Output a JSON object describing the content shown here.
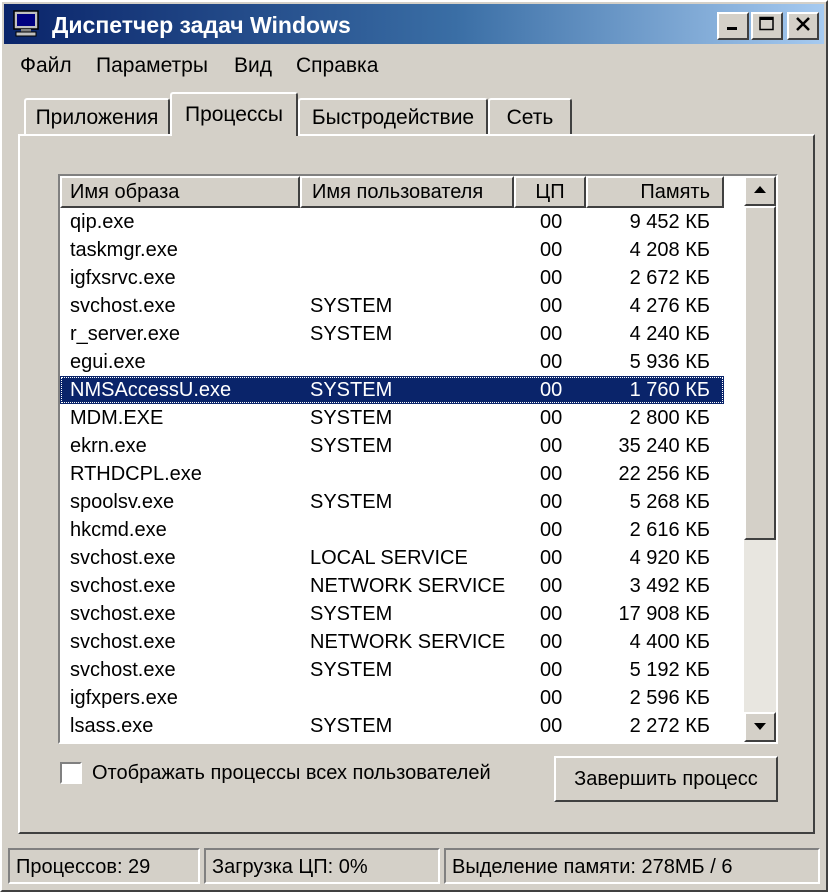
{
  "window": {
    "title": "Диспетчер задач Windows"
  },
  "menu": [
    {
      "label": "Файл"
    },
    {
      "label": "Параметры"
    },
    {
      "label": "Вид"
    },
    {
      "label": "Справка"
    }
  ],
  "tabs": [
    {
      "label": "Приложения",
      "active": false
    },
    {
      "label": "Процессы",
      "active": true
    },
    {
      "label": "Быстродействие",
      "active": false
    },
    {
      "label": "Сеть",
      "active": false
    }
  ],
  "table": {
    "columns": [
      "Имя образа",
      "Имя пользователя",
      "ЦП",
      "Память"
    ],
    "rows": [
      {
        "name": "qip.exe",
        "user": "",
        "cpu": "00",
        "mem": "9 452 КБ"
      },
      {
        "name": "taskmgr.exe",
        "user": "",
        "cpu": "00",
        "mem": "4 208 КБ"
      },
      {
        "name": "igfxsrvc.exe",
        "user": "",
        "cpu": "00",
        "mem": "2 672 КБ"
      },
      {
        "name": "svchost.exe",
        "user": "SYSTEM",
        "cpu": "00",
        "mem": "4 276 КБ"
      },
      {
        "name": "r_server.exe",
        "user": "SYSTEM",
        "cpu": "00",
        "mem": "4 240 КБ"
      },
      {
        "name": "egui.exe",
        "user": "",
        "cpu": "00",
        "mem": "5 936 КБ"
      },
      {
        "name": "NMSAccessU.exe",
        "user": "SYSTEM",
        "cpu": "00",
        "mem": "1 760 КБ",
        "selected": true
      },
      {
        "name": "MDM.EXE",
        "user": "SYSTEM",
        "cpu": "00",
        "mem": "2 800 КБ"
      },
      {
        "name": "ekrn.exe",
        "user": "SYSTEM",
        "cpu": "00",
        "mem": "35 240 КБ"
      },
      {
        "name": "RTHDCPL.exe",
        "user": "",
        "cpu": "00",
        "mem": "22 256 КБ"
      },
      {
        "name": "spoolsv.exe",
        "user": "SYSTEM",
        "cpu": "00",
        "mem": "5 268 КБ"
      },
      {
        "name": "hkcmd.exe",
        "user": "",
        "cpu": "00",
        "mem": "2 616 КБ"
      },
      {
        "name": "svchost.exe",
        "user": "LOCAL SERVICE",
        "cpu": "00",
        "mem": "4 920 КБ"
      },
      {
        "name": "svchost.exe",
        "user": "NETWORK SERVICE",
        "cpu": "00",
        "mem": "3 492 КБ"
      },
      {
        "name": "svchost.exe",
        "user": "SYSTEM",
        "cpu": "00",
        "mem": "17 908 КБ"
      },
      {
        "name": "svchost.exe",
        "user": "NETWORK SERVICE",
        "cpu": "00",
        "mem": "4 400 КБ"
      },
      {
        "name": "svchost.exe",
        "user": "SYSTEM",
        "cpu": "00",
        "mem": "5 192 КБ"
      },
      {
        "name": "igfxpers.exe",
        "user": "",
        "cpu": "00",
        "mem": "2 596 КБ"
      },
      {
        "name": "lsass.exe",
        "user": "SYSTEM",
        "cpu": "00",
        "mem": "2 272 КБ"
      }
    ]
  },
  "checkbox": {
    "label": "Отображать процессы всех пользователей",
    "checked": false
  },
  "end_button": {
    "label": "Завершить процесс"
  },
  "status": {
    "processes": "Процессов: 29",
    "cpu": "Загрузка ЦП: 0%",
    "memory": "Выделение памяти: 278МБ / 6"
  },
  "icons": {
    "app": "monitor-icon",
    "minimize": "minimize-icon",
    "maximize": "maximize-icon",
    "close": "close-icon",
    "scroll_up": "arrow-up-icon",
    "scroll_down": "arrow-down-icon"
  },
  "colors": {
    "title_start": "#0a246a",
    "title_end": "#a6caf0",
    "selection": "#0a246a",
    "face": "#d4d0c8"
  }
}
